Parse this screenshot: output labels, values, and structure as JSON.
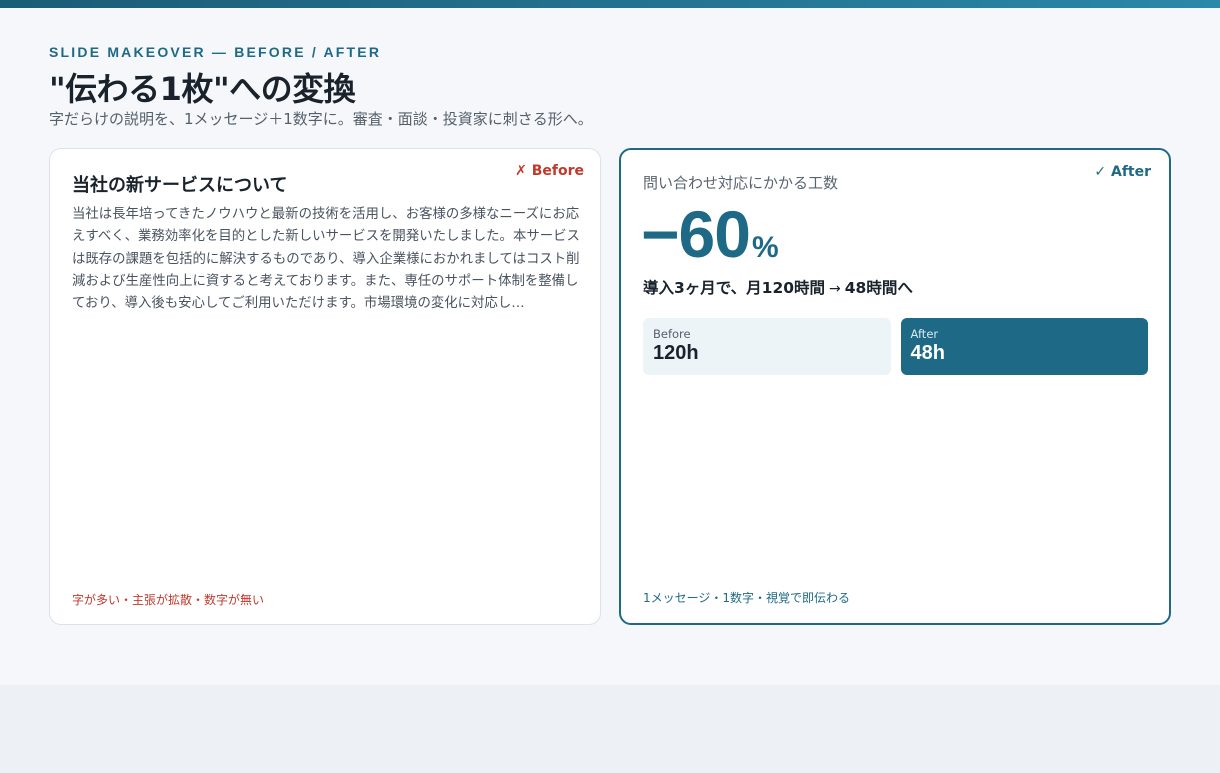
{
  "header": {
    "eyebrow": "SLIDE MAKEOVER — BEFORE / AFTER",
    "title": "\"伝わる1枚\"への変換",
    "subtitle": "字だらけの説明を、1メッセージ＋1数字に。審査・面談・投資家に刺さる形へ。"
  },
  "before_card": {
    "tag": "✗ Before",
    "heading": "当社の新サービスについて",
    "body": "当社は長年培ってきたノウハウと最新の技術を活用し、お客様の多様なニーズにお応えすべく、業務効率化を目的とした新しいサービスを開発いたしました。本サービスは既存の課題を包括的に解決するものであり、導入企業様におかれましてはコスト削減および生産性向上に資すると考えております。また、専任のサポート体制を整備しており、導入後も安心してご利用いただけます。市場環境の変化に対応し…",
    "footnote": "字が多い・主張が拡散・数字が無い"
  },
  "after_card": {
    "tag": "✓ After",
    "metric_label": "問い合わせ対応にかかる工数",
    "big_number": "−60",
    "big_unit": "%",
    "change_from": "導入3ヶ月で、月120時間",
    "change_arrow": "→",
    "change_to": "48時間へ",
    "compare": {
      "before_label": "Before",
      "before_value": "120h",
      "after_label": "After",
      "after_value": "48h"
    },
    "footnote": "1メッセージ・1数字・視覚で即伝わる"
  },
  "colors": {
    "accent": "#1e6a86",
    "bad": "#c0392b",
    "background": "#f5f7fa"
  }
}
